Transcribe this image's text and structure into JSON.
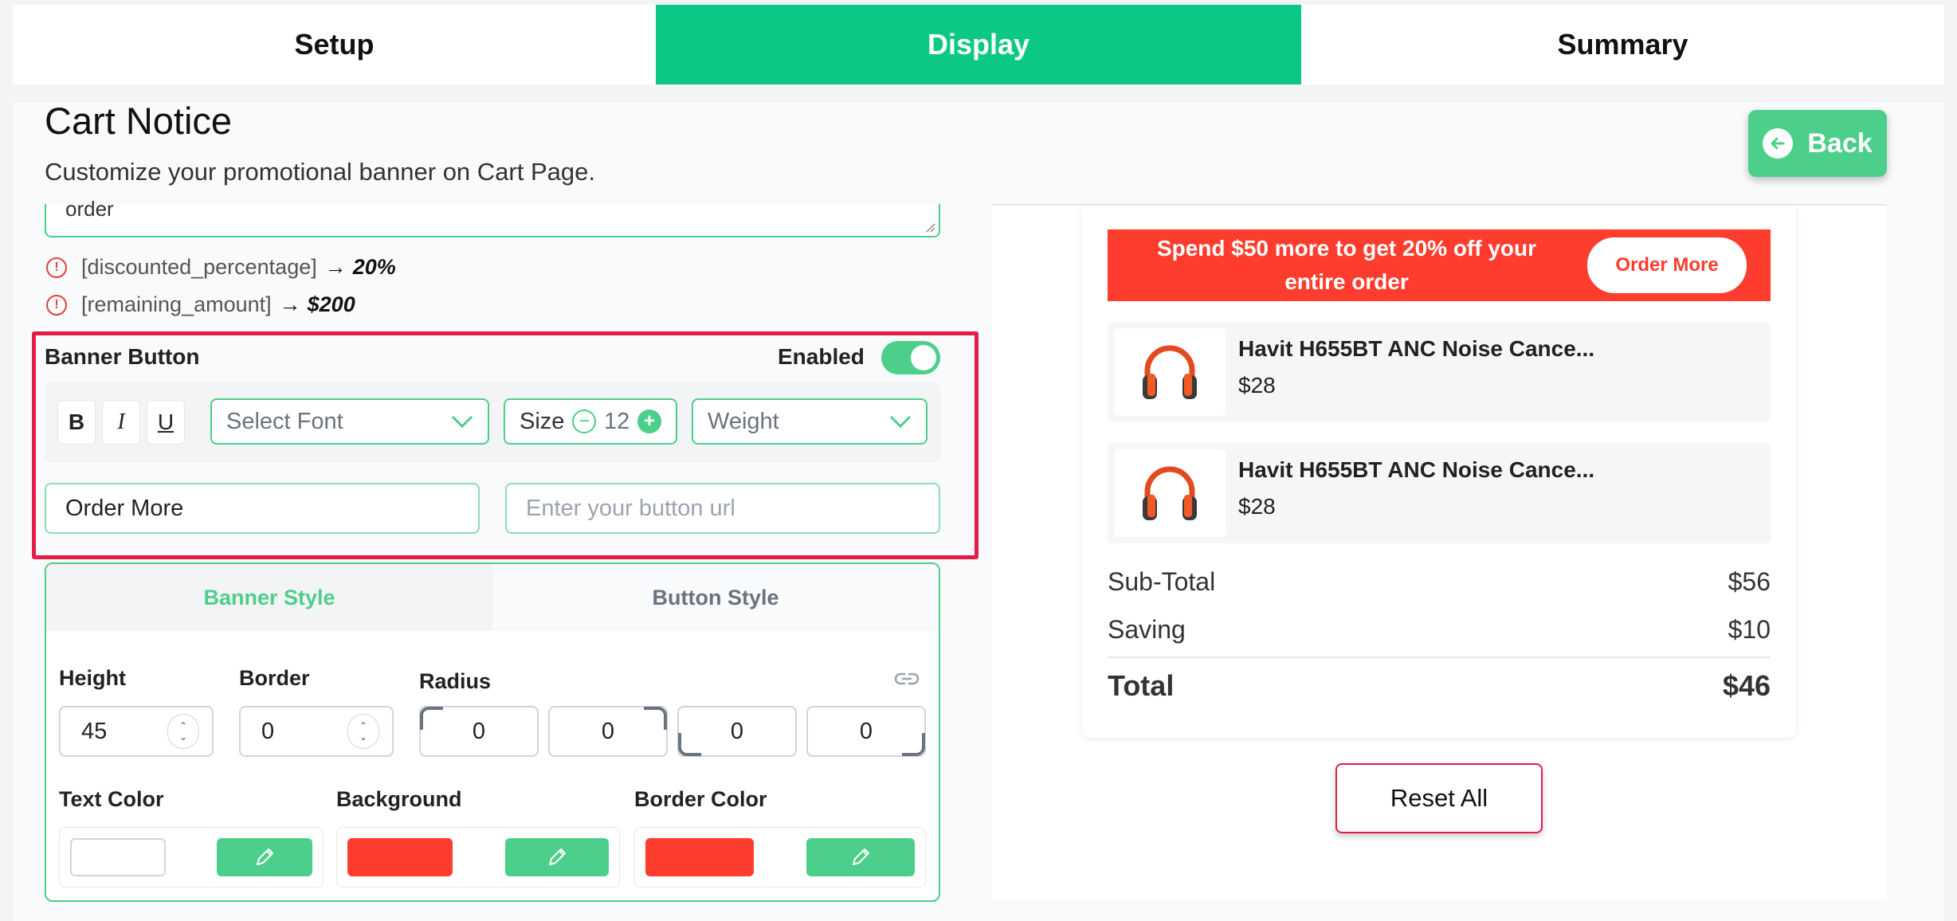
{
  "tabs": [
    {
      "label": "Setup"
    },
    {
      "label": "Display"
    },
    {
      "label": "Summary"
    }
  ],
  "header": {
    "title": "Cart Notice",
    "subtitle": "Customize your promotional banner on Cart Page.",
    "back_label": "Back"
  },
  "message_field": {
    "value_tail": "order"
  },
  "variables": [
    {
      "token": "[discounted_percentage]",
      "arrow": "→",
      "value": "20%"
    },
    {
      "token": "[remaining_amount]",
      "arrow": "→",
      "value": "$200"
    }
  ],
  "banner_button": {
    "heading": "Banner Button",
    "enabled_label": "Enabled",
    "enabled": true,
    "bold": "B",
    "italic": "I",
    "underline": "U",
    "font_placeholder": "Select Font",
    "size_label": "Size",
    "size_value": "12",
    "weight_placeholder": "Weight",
    "text_value": "Order More",
    "url_placeholder": "Enter your button url"
  },
  "style_tabs": {
    "banner": "Banner Style",
    "button": "Button Style"
  },
  "banner_style": {
    "height_label": "Height",
    "height_value": "45",
    "border_label": "Border",
    "border_value": "0",
    "radius_label": "Radius",
    "radius_values": [
      "0",
      "0",
      "0",
      "0"
    ],
    "text_color_label": "Text Color",
    "background_label": "Background",
    "border_color_label": "Border Color"
  },
  "colors": {
    "accent": "#0bc985",
    "green": "#4ccf8a",
    "banner_red": "#ff3d2e",
    "highlight": "#e11d48"
  },
  "preview": {
    "banner_text": "Spend $50 more to get 20% off your entire order",
    "banner_button": "Order More",
    "products": [
      {
        "name": "Havit H655BT ANC Noise Cance...",
        "price": "$28",
        "icon": "headphones-icon"
      },
      {
        "name": "Havit H655BT ANC Noise Cance...",
        "price": "$28",
        "icon": "headphones-icon"
      }
    ],
    "subtotal_label": "Sub-Total",
    "subtotal_value": "$56",
    "saving_label": "Saving",
    "saving_value": "$10",
    "total_label": "Total",
    "total_value": "$46",
    "reset_label": "Reset All"
  }
}
